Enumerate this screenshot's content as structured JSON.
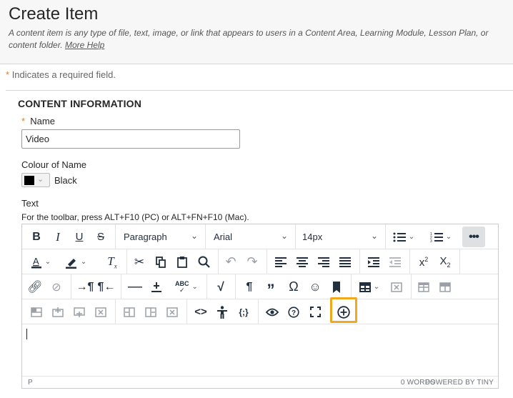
{
  "header": {
    "title": "Create Item",
    "description": "A content item is any type of file, text, image, or link that appears to users in a Content Area, Learning Module, Lesson Plan, or content folder.",
    "more_help": "More Help"
  },
  "required_note": {
    "star": "*",
    "text": "Indicates a required field."
  },
  "section": {
    "title": "CONTENT INFORMATION",
    "name_label": "Name",
    "name_value": "Video",
    "colour_label": "Colour of Name",
    "colour_value": "Black",
    "text_label": "Text",
    "toolbar_hint": "For the toolbar, press ALT+F10 (PC) or ALT+FN+F10 (Mac)."
  },
  "editor": {
    "block_format": "Paragraph",
    "font_family": "Arial",
    "font_size": "14px",
    "status_path": "P",
    "word_count": "0 WORDS",
    "powered_by": "POWERED BY TINY"
  },
  "colors": {
    "accent_star": "#d9822b",
    "highlight": "#f2a81d",
    "icon": "#222f3e"
  }
}
